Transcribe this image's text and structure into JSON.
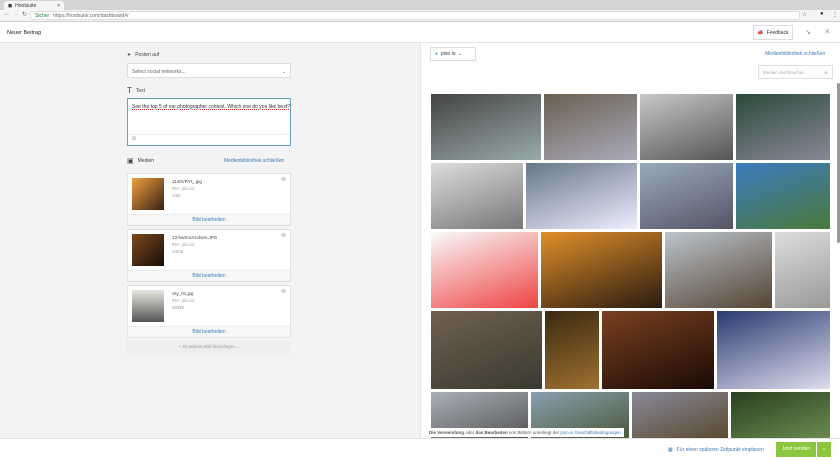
{
  "browser": {
    "tab_title": "Hootsuite",
    "secure": "Sicher",
    "url": "https://hootsuite.com/dashboard#/"
  },
  "header": {
    "title": "Neuer Beitrag",
    "feedback": "Feedback"
  },
  "compose": {
    "post_to_label": "Posten auf",
    "networks_placeholder": "Select social networks...",
    "text_label": "Text",
    "text_value": "See the top 5 of our photographer contest. Which one do you like best?",
    "media_label": "Medien",
    "close_library": "Medienbibliothek schließen",
    "media": [
      {
        "name": "1140VRYt_.jpg",
        "source": "Per: pixo.io",
        "size": "1mb",
        "edit": "Bild bearbeiten",
        "colors": [
          "#f0a040",
          "#3a2010"
        ]
      },
      {
        "name": "13-hartmut-tobies.JPG",
        "source": "Per: pixo.io",
        "size": "13mb",
        "edit": "Bild bearbeiten",
        "colors": [
          "#7a4a20",
          "#1a0c05"
        ]
      },
      {
        "name": "city_01.jpg",
        "source": "Per: pixo.io",
        "size": "383kb",
        "edit": "Bild bearbeiten",
        "colors": [
          "#e8e8e0",
          "#555"
        ]
      }
    ],
    "add_more": "+ 20 weitere Bild hinzufügen ..."
  },
  "library": {
    "source": "pixo.io",
    "close": "Medienbibliothek schließen",
    "search_placeholder": "Medien durchsuchen ...",
    "tiles": [
      [
        "#444",
        "#9aa"
      ],
      [
        "#6a6050",
        "#aab"
      ],
      [
        "#c8c8c8",
        "#555"
      ],
      [
        "#2c4a3a",
        "#889"
      ],
      [
        "#ddd",
        "#777"
      ],
      [
        "#667788",
        "#eef"
      ],
      [
        "#9ab",
        "#556"
      ],
      [
        "#3b7bc0",
        "#4a7a3a"
      ],
      [
        "#fafafa",
        "#e44"
      ],
      [
        "#e0902a",
        "#2a1a10"
      ],
      [
        "#bcc4cc",
        "#554433"
      ],
      [
        "#ddd",
        "#999"
      ],
      [
        "#706050",
        "#3a3a30"
      ],
      [
        "#3a2a10",
        "#a07030"
      ],
      [
        "#7a4020",
        "#1a0a05"
      ],
      [
        "#2a3a70",
        "#dde"
      ],
      [
        "#aab0b8",
        "#555"
      ],
      [
        "#8aa0b0",
        "#4a5a3a"
      ],
      [
        "#889",
        "#5a4a30"
      ],
      [
        "#2a4020",
        "#6a8a50"
      ]
    ],
    "notice_bold1": "Die Verwendung",
    "notice_mid1": " oder ",
    "notice_bold2": "das Bearbeiten",
    "notice_mid2": " von Bildern unterliegt der ",
    "notice_link": "pixo.io Geschäftsbedingungen"
  },
  "footer": {
    "schedule": "Für einen späteren Zeitpunkt einplanen",
    "send": "Jetzt senden",
    "accent": "#8cc63f"
  }
}
